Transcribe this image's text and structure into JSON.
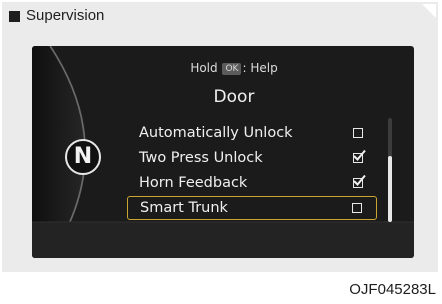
{
  "header": {
    "title": "Supervision"
  },
  "display": {
    "hint_prefix": "Hold",
    "hint_key": "OK",
    "hint_suffix": ": Help",
    "gear_indicator": "N",
    "title": "Door",
    "menu_items": [
      {
        "label": "Automatically Unlock",
        "checked": false,
        "selected": false
      },
      {
        "label": "Two Press Unlock",
        "checked": true,
        "selected": false
      },
      {
        "label": "Horn Feedback",
        "checked": true,
        "selected": false
      },
      {
        "label": "Smart Trunk",
        "checked": false,
        "selected": true
      }
    ],
    "scroll_position": 0.37
  },
  "figure": {
    "code": "OJF045283L"
  },
  "colors": {
    "screen_background": "#1b1b1b",
    "selection_border": "#c9a632",
    "text": "#f0f0f0"
  }
}
